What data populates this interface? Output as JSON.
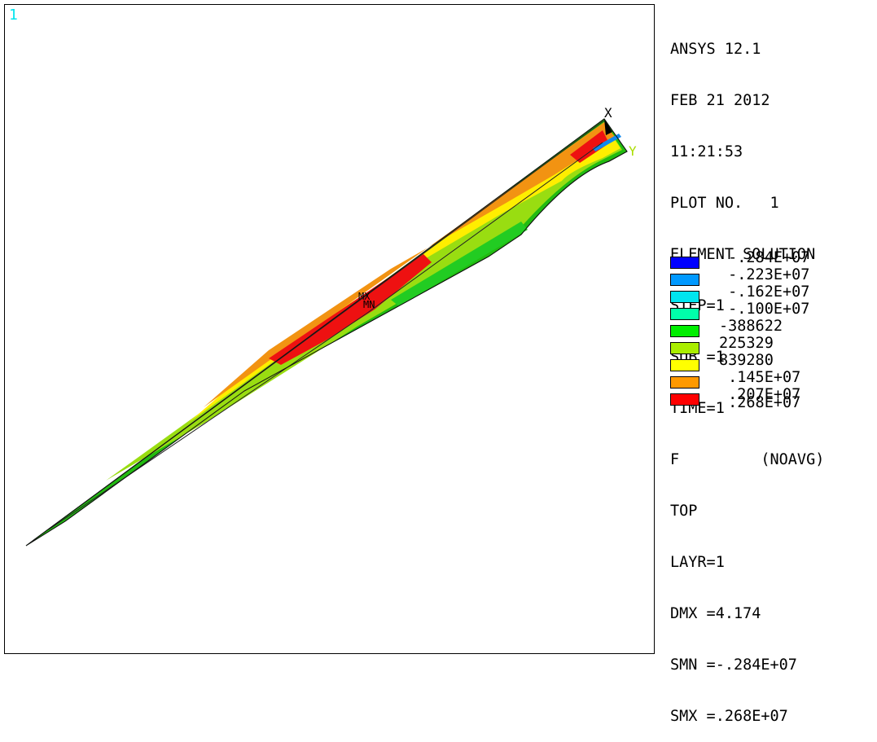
{
  "window": {
    "number": "1"
  },
  "info": {
    "lines": [
      "ANSYS 12.1",
      "FEB 21 2012",
      "11:21:53",
      "PLOT NO.   1",
      "ELEMENT SOLUTION",
      "STEP=1",
      "SUB =1",
      "TIME=1",
      "F         (NOAVG)",
      "TOP",
      "LAYR=1",
      "DMX =4.174",
      "SMN =-.284E+07",
      "SMX =.268E+07"
    ]
  },
  "legend": {
    "values": [
      " -.284E+07",
      " -.223E+07",
      " -.162E+07",
      " -.100E+07",
      "-388622",
      "225329",
      "839280",
      " .145E+07",
      " .207E+07",
      " .268E+07"
    ],
    "colors": [
      "#0000ff",
      "#0099ff",
      "#00e5ef",
      "#00ffaa",
      "#00ee00",
      "#aaee00",
      "#ffff00",
      "#ff9900",
      "#ff0000"
    ]
  },
  "labels": {
    "axis_x": "X",
    "axis_y": "Y",
    "mx": "MX",
    "mn": "MN"
  }
}
